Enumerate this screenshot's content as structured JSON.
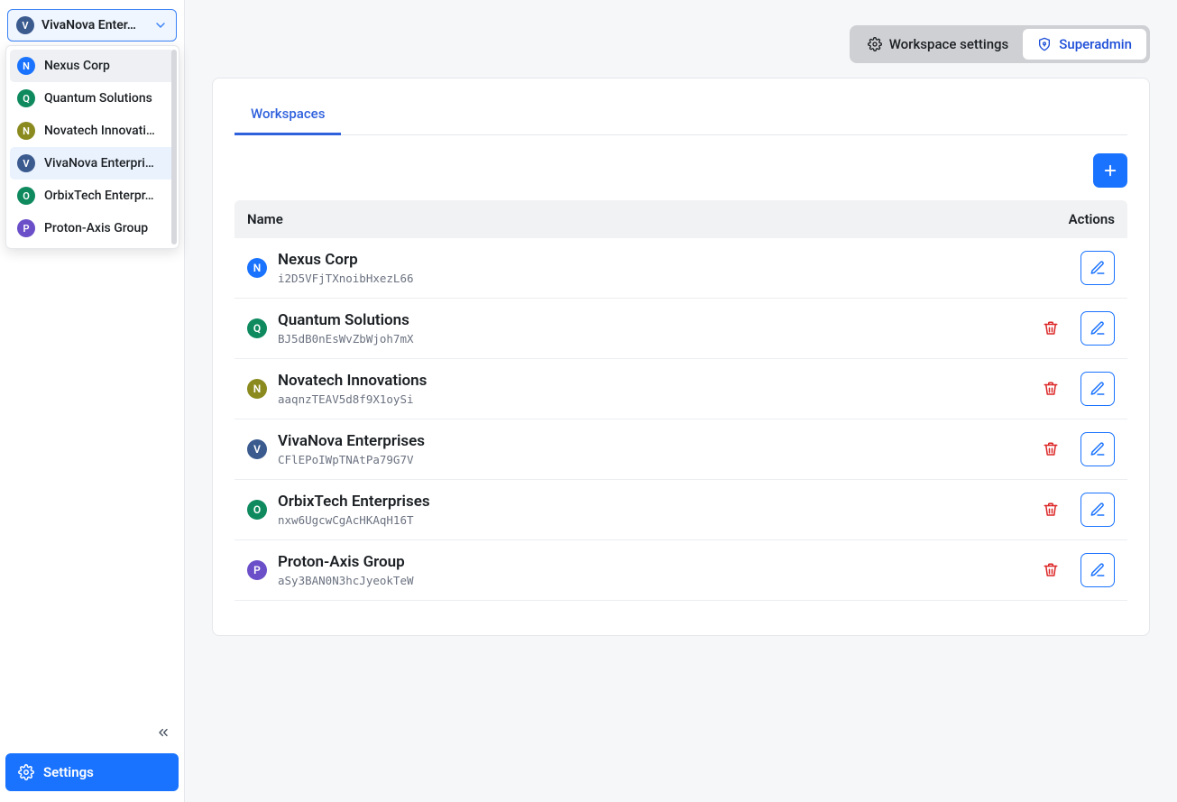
{
  "colors": {
    "blue": "#1a73ff",
    "green": "#0f8a5f",
    "olive": "#8a8a1f",
    "slate": "#3b5b8f",
    "purple": "#6b4fc9"
  },
  "selector": {
    "selected_label": "VivaNova Enter…"
  },
  "dropdown_items": [
    {
      "letter": "N",
      "color": "#1a73ff",
      "label": "Nexus Corp",
      "hovered": true,
      "selected": false
    },
    {
      "letter": "Q",
      "color": "#0f8a5f",
      "label": "Quantum Solutions",
      "hovered": false,
      "selected": false
    },
    {
      "letter": "N",
      "color": "#8a8a1f",
      "label": "Novatech Innovati…",
      "hovered": false,
      "selected": false
    },
    {
      "letter": "V",
      "color": "#3b5b8f",
      "label": "VivaNova Enterpri…",
      "hovered": false,
      "selected": true
    },
    {
      "letter": "O",
      "color": "#0f8a5f",
      "label": "OrbixTech Enterpr…",
      "hovered": false,
      "selected": false
    },
    {
      "letter": "P",
      "color": "#6b4fc9",
      "label": "Proton-Axis Group",
      "hovered": false,
      "selected": false
    }
  ],
  "sidebar": {
    "settings_label": "Settings"
  },
  "segmented": {
    "workspace_settings": "Workspace settings",
    "superadmin": "Superadmin"
  },
  "tabs": {
    "workspaces": "Workspaces"
  },
  "table": {
    "headers": {
      "name": "Name",
      "actions": "Actions"
    }
  },
  "workspaces": [
    {
      "letter": "N",
      "color": "#1a73ff",
      "name": "Nexus Corp",
      "id": "i2D5VFjTXnoibHxezL66",
      "deletable": false
    },
    {
      "letter": "Q",
      "color": "#0f8a5f",
      "name": "Quantum Solutions",
      "id": "BJ5dB0nEsWvZbWjoh7mX",
      "deletable": true
    },
    {
      "letter": "N",
      "color": "#8a8a1f",
      "name": "Novatech Innovations",
      "id": "aaqnzTEAV5d8f9X1oySi",
      "deletable": true
    },
    {
      "letter": "V",
      "color": "#3b5b8f",
      "name": "VivaNova Enterprises",
      "id": "CFlEPoIWpTNAtPa79G7V",
      "deletable": true
    },
    {
      "letter": "O",
      "color": "#0f8a5f",
      "name": "OrbixTech Enterprises",
      "id": "nxw6UgcwCgAcHKAqH16T",
      "deletable": true
    },
    {
      "letter": "P",
      "color": "#6b4fc9",
      "name": "Proton-Axis Group",
      "id": "aSy3BAN0N3hcJyeokTeW",
      "deletable": true
    }
  ]
}
